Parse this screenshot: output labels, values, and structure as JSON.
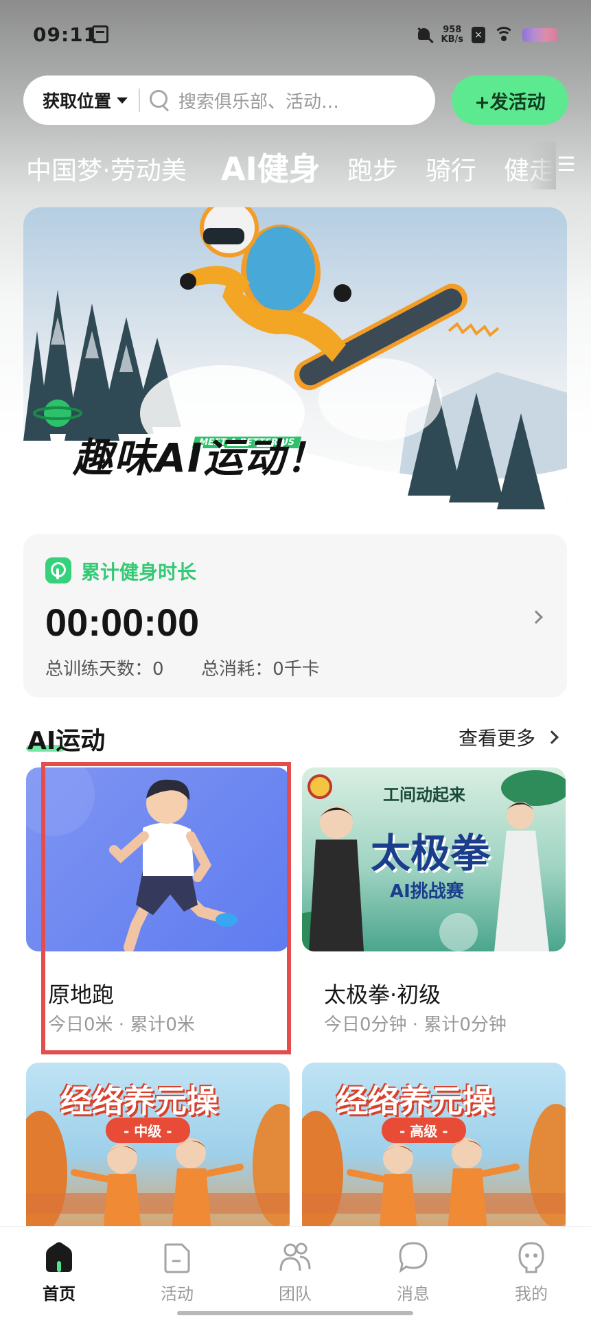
{
  "status_bar": {
    "time": "09:11",
    "net_speed_value": "958",
    "net_speed_unit": "KB/s"
  },
  "header": {
    "location_label": "获取位置",
    "search_placeholder": "搜索俱乐部、活动…",
    "post_button": "+发活动"
  },
  "tabs": [
    {
      "label": "中国梦·劳动美",
      "active": false
    },
    {
      "label": "AI健身",
      "active": true
    },
    {
      "label": "跑步",
      "active": false
    },
    {
      "label": "骑行",
      "active": false
    },
    {
      "label": "健走",
      "active": false
    }
  ],
  "banner": {
    "title": "趣味AI运动！",
    "tagline": "MEET A BETTER US"
  },
  "stats": {
    "title": "累计健身时长",
    "duration": "00:00:00",
    "days_label": "总训练天数：",
    "days_value": "0",
    "calories_label": "总消耗：",
    "calories_value": "0千卡"
  },
  "section": {
    "title": "AI运动",
    "more": "查看更多"
  },
  "cards": [
    {
      "name": "原地跑",
      "meta": "今日0米 · 累计0米"
    },
    {
      "name": "太极拳·初级",
      "meta": "今日0分钟 · 累计0分钟",
      "thumb_title": "太极拳",
      "thumb_sub": "AI挑战赛",
      "thumb_top": "工间动起来"
    },
    {
      "thumb_title": "经络养元操",
      "thumb_level": "- 中级 -"
    },
    {
      "thumb_title": "经络养元操",
      "thumb_level": "- 高级 -"
    }
  ],
  "nav": [
    {
      "label": "首页",
      "icon": "home-icon",
      "active": true
    },
    {
      "label": "活动",
      "icon": "activity-icon",
      "active": false
    },
    {
      "label": "团队",
      "icon": "team-icon",
      "active": false
    },
    {
      "label": "消息",
      "icon": "message-icon",
      "active": false
    },
    {
      "label": "我的",
      "icon": "profile-icon",
      "active": false
    }
  ],
  "colors": {
    "accent_green": "#5de98f",
    "stats_green": "#34c975",
    "highlight_red": "#e54d4d"
  }
}
